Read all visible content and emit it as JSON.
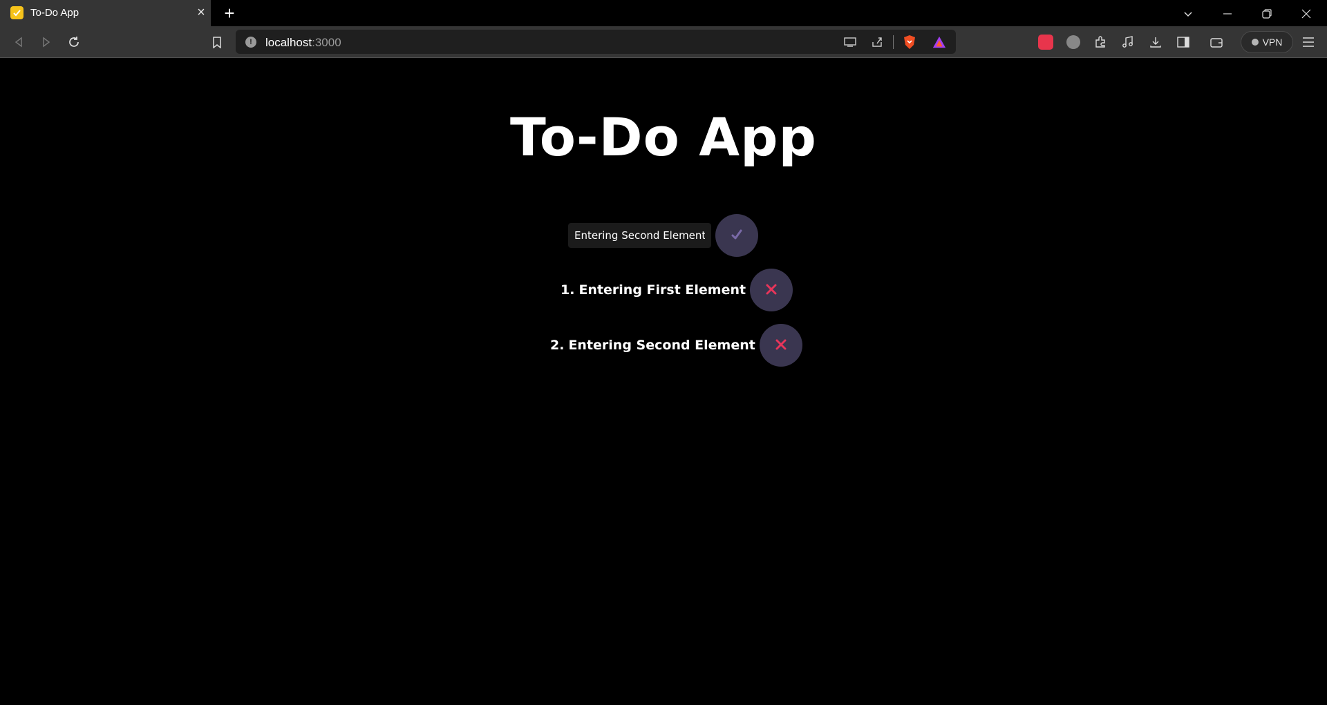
{
  "browser": {
    "tab": {
      "title": "To-Do App",
      "favicon": "checkmark-icon"
    },
    "url": {
      "host": "localhost",
      "port": ":3000"
    },
    "vpn_label": "VPN"
  },
  "app": {
    "title": "To-Do App",
    "input": {
      "value": "Entering Second Element"
    },
    "add_icon": "checkmark-icon",
    "todos": [
      {
        "number": "1.",
        "text": "Entering First Element"
      },
      {
        "number": "2.",
        "text": "Entering Second Element"
      }
    ],
    "delete_icon": "close-icon"
  },
  "colors": {
    "background": "#000000",
    "circle_button": "#3a3650",
    "check": "#7a6aa8",
    "delete_x": "#e8355a",
    "input_bg": "#1b1b1b"
  }
}
